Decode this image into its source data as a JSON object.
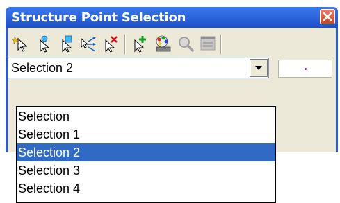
{
  "window": {
    "title": "Structure Point Selection"
  },
  "toolbar": {
    "buttons": [
      {
        "icon": "select-point-arrow-icon"
      },
      {
        "icon": "select-point-circle-icon"
      },
      {
        "icon": "select-point-add-icon"
      },
      {
        "icon": "select-point-multi-icon"
      },
      {
        "icon": "deselect-point-icon"
      },
      {
        "icon": "add-point-icon"
      },
      {
        "icon": "color-palette-icon"
      },
      {
        "icon": "zoom-icon"
      },
      {
        "icon": "window-icon"
      }
    ]
  },
  "selection_combo": {
    "value": "Selection 2"
  },
  "color_swatch": {
    "color": "#9a10d0"
  },
  "dropdown": {
    "items": [
      {
        "label": "Selection",
        "selected": false
      },
      {
        "label": "Selection 1",
        "selected": false
      },
      {
        "label": "Selection 2",
        "selected": true
      },
      {
        "label": "Selection 3",
        "selected": false
      },
      {
        "label": "Selection 4",
        "selected": false
      }
    ]
  },
  "colors": {
    "titlebar": "#2a5bd2",
    "selected_item": "#316ac5",
    "panel": "#ece9d8"
  }
}
